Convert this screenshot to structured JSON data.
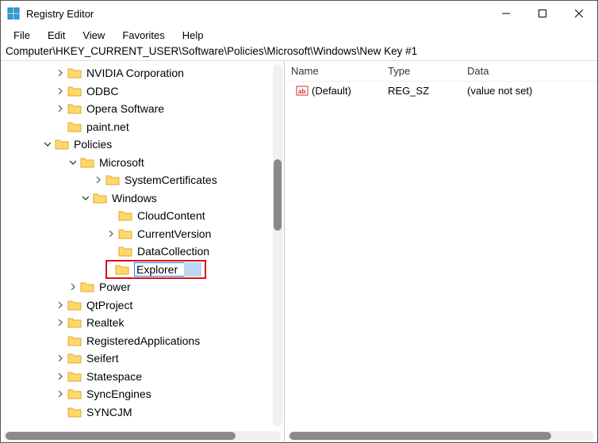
{
  "window": {
    "title": "Registry Editor"
  },
  "menu": {
    "file": "File",
    "edit": "Edit",
    "view": "View",
    "favorites": "Favorites",
    "help": "Help"
  },
  "address": "Computer\\HKEY_CURRENT_USER\\Software\\Policies\\Microsoft\\Windows\\New Key #1",
  "tree": {
    "nvidia": "NVIDIA Corporation",
    "odbc": "ODBC",
    "opera": "Opera Software",
    "paintnet": "paint.net",
    "policies": "Policies",
    "microsoft": "Microsoft",
    "syscert": "SystemCertificates",
    "windows": "Windows",
    "cloud": "CloudContent",
    "curver": "CurrentVersion",
    "datacol": "DataCollection",
    "explorer_edit": "Explorer",
    "power": "Power",
    "qtproject": "QtProject",
    "realtek": "Realtek",
    "regapps": "RegisteredApplications",
    "seifert": "Seifert",
    "statespace": "Statespace",
    "syncengines": "SyncEngines",
    "syncjm": "SYNCJM"
  },
  "list": {
    "headers": {
      "name": "Name",
      "type": "Type",
      "data": "Data"
    },
    "rows": [
      {
        "name": "(Default)",
        "type": "REG_SZ",
        "data": "(value not set)"
      }
    ]
  }
}
